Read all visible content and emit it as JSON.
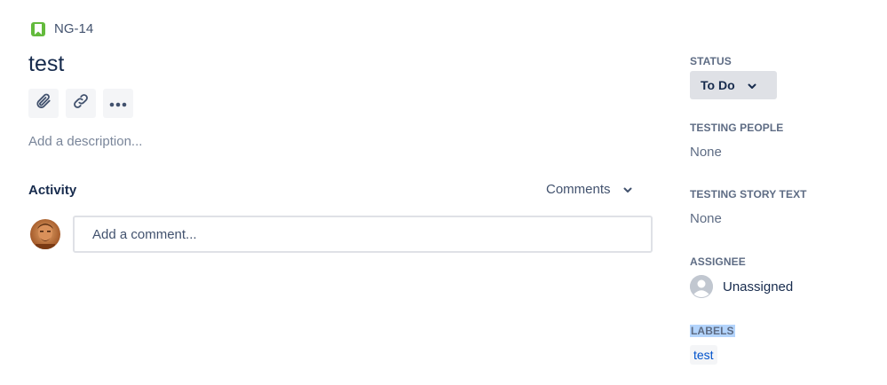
{
  "issue": {
    "key": "NG-14",
    "summary": "test",
    "description_placeholder": "Add a description..."
  },
  "toolbar": {
    "buttons": [
      {
        "icon": "attachment-icon"
      },
      {
        "icon": "link-icon"
      },
      {
        "icon": "more-icon"
      }
    ]
  },
  "activity": {
    "label": "Activity",
    "filter_label": "Comments",
    "comment_placeholder": "Add a comment..."
  },
  "fields": {
    "status": {
      "label": "STATUS",
      "value": "To Do"
    },
    "testing_people": {
      "label": "TESTING PEOPLE",
      "value": "None"
    },
    "testing_story_text": {
      "label": "TESTING STORY TEXT",
      "value": "None"
    },
    "assignee": {
      "label": "ASSIGNEE",
      "value": "Unassigned"
    },
    "labels": {
      "label": "LABELS",
      "items": [
        "test"
      ]
    }
  },
  "colors": {
    "story_icon": "#63ba3c",
    "label_link": "#0052cc",
    "status_bg": "#dfe1e6",
    "selection_highlight": "#b3d4fc"
  }
}
